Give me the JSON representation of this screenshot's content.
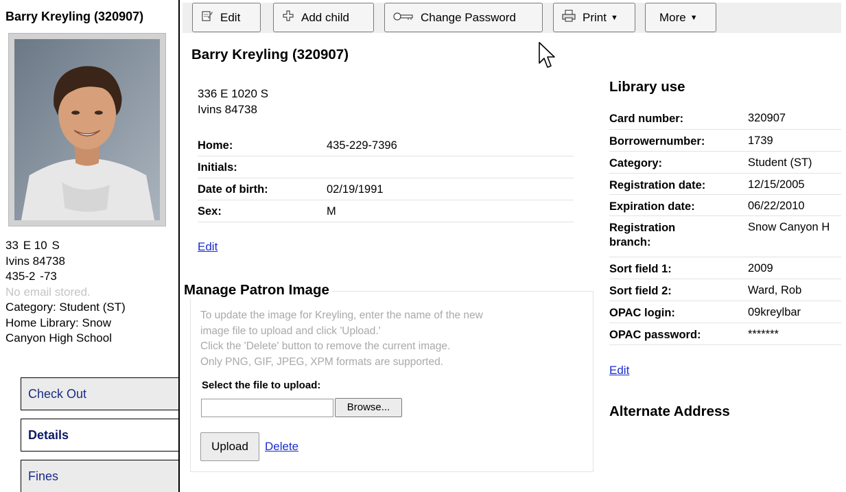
{
  "sidebar": {
    "patron_name": "Barry Kreyling (320907)",
    "info": {
      "street": "33  E 10  S",
      "city": "Ivins 84738",
      "phone": "435-2  -73  ",
      "email": "No email stored.",
      "category": "Category: Student (ST)",
      "home_library_1": "Home Library: Snow",
      "home_library_2": "Canyon High School"
    },
    "tabs": [
      {
        "label": "Check Out",
        "active": false
      },
      {
        "label": "Details",
        "active": true
      },
      {
        "label": "Fines",
        "active": false
      }
    ]
  },
  "toolbar": {
    "edit": "Edit",
    "add_child": "Add child",
    "change_password": "Change Password",
    "print": "Print",
    "more": "More"
  },
  "main": {
    "title": "Barry Kreyling (320907)",
    "address_line1": "336 E 1020 S",
    "address_line2": "Ivins 84738",
    "details": [
      {
        "label": "Home:",
        "value": "435-229-7396"
      },
      {
        "label": "Initials:",
        "value": ""
      },
      {
        "label": "Date of birth:",
        "value": "02/19/1991"
      },
      {
        "label": "Sex:",
        "value": "M"
      }
    ],
    "edit_link": "Edit"
  },
  "patron_image": {
    "title": "Manage Patron Image",
    "help": [
      "To update the image for Kreyling, enter the name of the new",
      "image file to upload and click 'Upload.'",
      "Click the 'Delete' button to remove the current image.",
      "Only PNG, GIF, JPEG, XPM formats are supported."
    ],
    "file_label": "Select the file to upload:",
    "file_value": "",
    "browse": "Browse...",
    "upload": "Upload",
    "delete": "Delete"
  },
  "library_use": {
    "title": "Library use",
    "rows": [
      {
        "label": "Card number:",
        "value": "320907"
      },
      {
        "label": "Borrowernumber:",
        "value": "1739"
      },
      {
        "label": "Category:",
        "value": "Student (ST)"
      },
      {
        "label": "Registration date:",
        "value": "12/15/2005"
      },
      {
        "label": "Expiration date:",
        "value": "06/22/2010"
      },
      {
        "label": "Registration branch:",
        "value": "Snow Canyon H"
      },
      {
        "label": "Sort field 1:",
        "value": "2009"
      },
      {
        "label": "Sort field 2:",
        "value": "Ward, Rob"
      },
      {
        "label": "OPAC login:",
        "value": "09kreylbar"
      },
      {
        "label": "OPAC password:",
        "value": "*******"
      }
    ],
    "edit_link": "Edit"
  },
  "alternate_address": {
    "title": "Alternate Address"
  }
}
